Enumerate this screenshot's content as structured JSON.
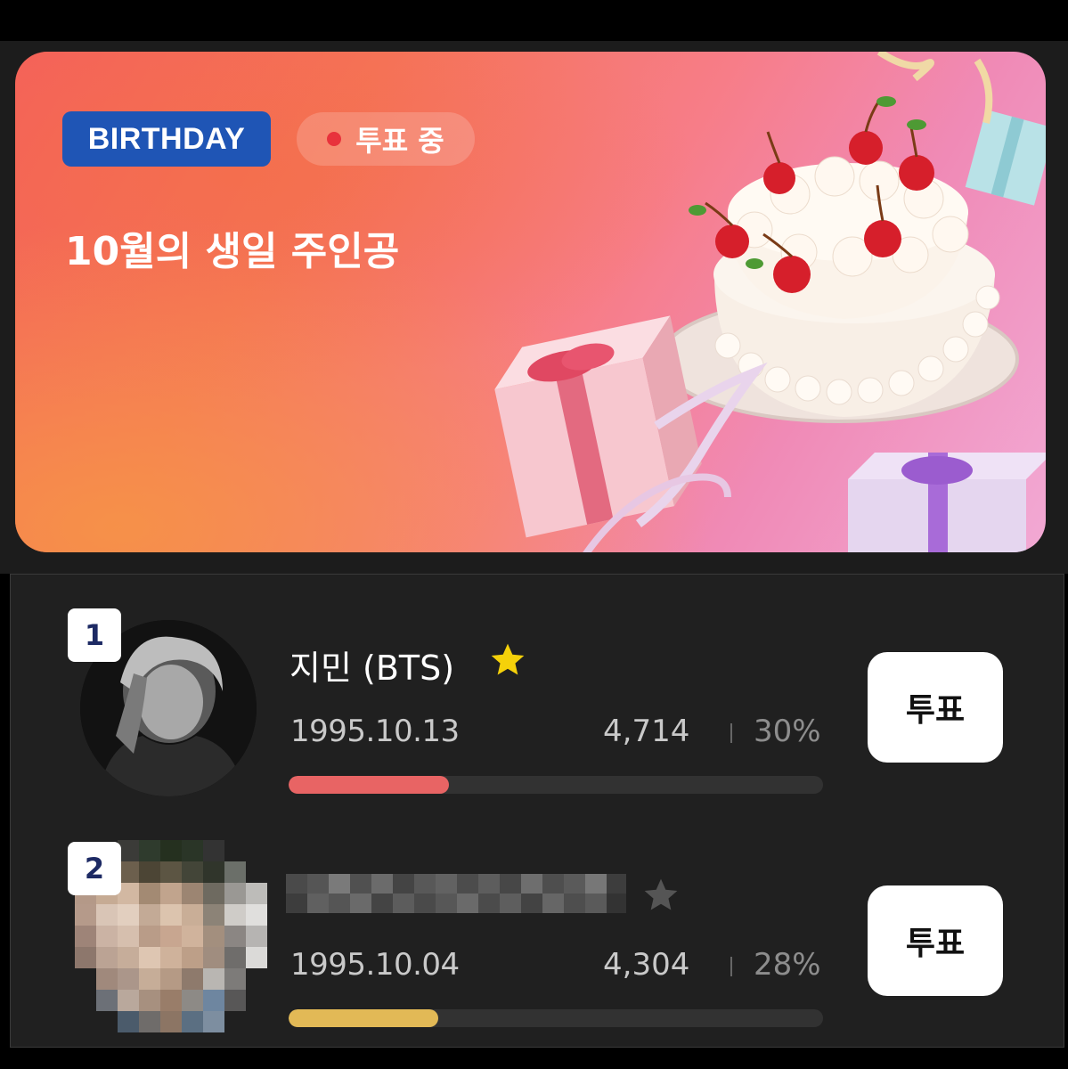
{
  "banner": {
    "badge": "BIRTHDAY",
    "status": "투표 중",
    "title": "10월의 생일 주인공"
  },
  "ranking": [
    {
      "rank": "1",
      "name": "지민 (BTS)",
      "birthdate": "1995.10.13",
      "votes": "4,714",
      "percent": "30%",
      "share": 0.3,
      "bar_color": "#e86464",
      "vote_label": "투표",
      "star_icon": "star-icon",
      "star_color": "#f5d10a"
    },
    {
      "rank": "2",
      "name": "",
      "birthdate": "1995.10.04",
      "votes": "4,304",
      "percent": "28%",
      "share": 0.28,
      "bar_color": "#e2b956",
      "vote_label": "투표",
      "star_icon": "star-icon",
      "star_color": "#555555"
    }
  ]
}
